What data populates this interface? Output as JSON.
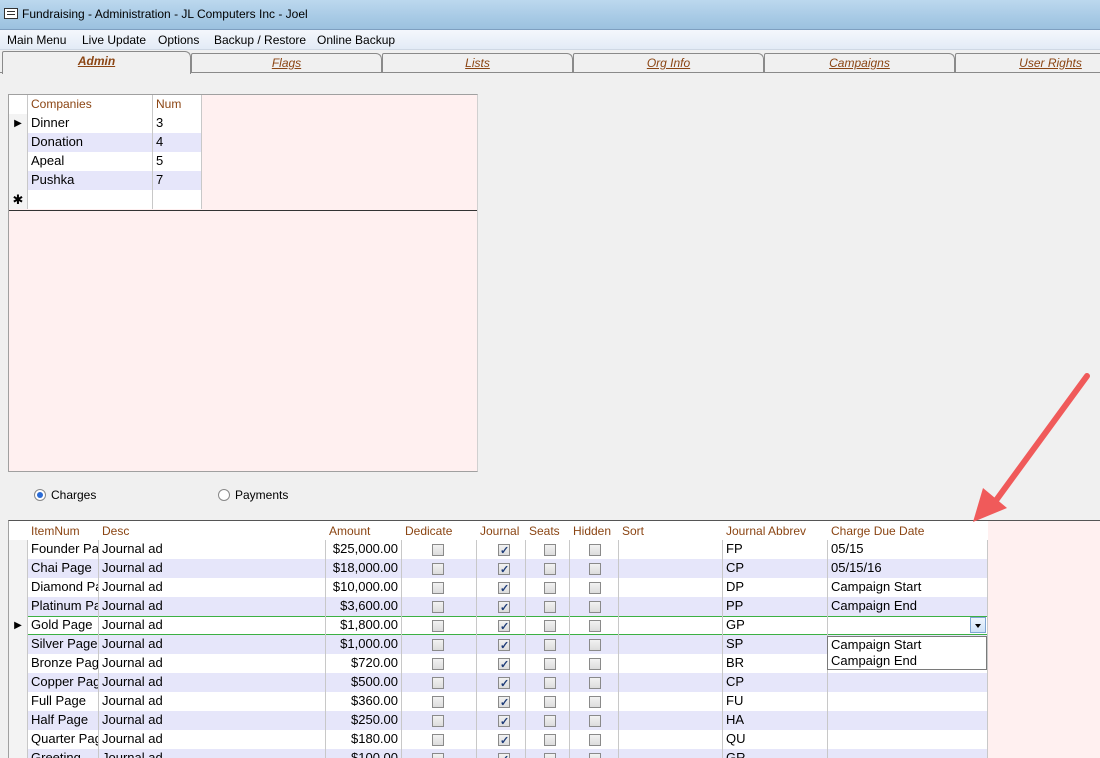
{
  "window": {
    "title": "Fundraising - Administration - JL Computers Inc - Joel"
  },
  "menu": [
    "Main Menu",
    "Live Update",
    "Options",
    "Backup / Restore",
    "Online Backup"
  ],
  "tabs": [
    "Admin",
    "Flags",
    "Lists",
    "Org Info",
    "Campaigns",
    "User Rights"
  ],
  "companies": {
    "headers": {
      "name": "Companies",
      "num": "Num"
    },
    "rows": [
      {
        "name": "Dinner",
        "num": "3"
      },
      {
        "name": "Donation",
        "num": "4"
      },
      {
        "name": "Apeal",
        "num": "5"
      },
      {
        "name": "Pushka",
        "num": "7"
      }
    ],
    "new_row_marker": "✱"
  },
  "radios": {
    "charges": "Charges",
    "payments": "Payments",
    "selected": "charges"
  },
  "charges": {
    "headers": {
      "itemnum": "ItemNum",
      "desc": "Desc",
      "amount": "Amount",
      "dedicate": "Dedicate",
      "journal": "Journal",
      "seats": "Seats",
      "hidden": "Hidden",
      "sort": "Sort",
      "abbrev": "Journal Abbrev",
      "due": "Charge Due Date"
    },
    "rows": [
      {
        "item": "Founder Pa",
        "desc": "Journal ad",
        "amount": "$25,000.00",
        "abbrev": "FP",
        "due": "05/15"
      },
      {
        "item": "Chai Page",
        "desc": "Journal ad",
        "amount": "$18,000.00",
        "abbrev": "CP",
        "due": "05/15/16"
      },
      {
        "item": "Diamond Pa",
        "desc": "Journal ad",
        "amount": "$10,000.00",
        "abbrev": "DP",
        "due": "Campaign Start"
      },
      {
        "item": "Platinum Pa",
        "desc": "Journal ad",
        "amount": "$3,600.00",
        "abbrev": "PP",
        "due": "Campaign End"
      },
      {
        "item": "Gold Page",
        "desc": "Journal ad",
        "amount": "$1,800.00",
        "abbrev": "GP",
        "due": ""
      },
      {
        "item": "Silver Page",
        "desc": "Journal ad",
        "amount": "$1,000.00",
        "abbrev": "SP",
        "due": ""
      },
      {
        "item": "Bronze Pag",
        "desc": "Journal ad",
        "amount": "$720.00",
        "abbrev": "BR",
        "due": ""
      },
      {
        "item": "Copper Pag",
        "desc": "Journal ad",
        "amount": "$500.00",
        "abbrev": "CP",
        "due": ""
      },
      {
        "item": "Full Page",
        "desc": "Journal ad",
        "amount": "$360.00",
        "abbrev": "FU",
        "due": ""
      },
      {
        "item": "Half Page",
        "desc": "Journal ad",
        "amount": "$250.00",
        "abbrev": "HA",
        "due": ""
      },
      {
        "item": "Quarter Pag",
        "desc": "Journal ad",
        "amount": "$180.00",
        "abbrev": "QU",
        "due": ""
      },
      {
        "item": "Greeting",
        "desc": "Journal ad",
        "amount": "$100.00",
        "abbrev": "GR",
        "due": ""
      }
    ],
    "current_row": 4,
    "dropdown_options": [
      "Campaign Start",
      "Campaign End"
    ]
  },
  "colors": {
    "header_text": "#8b4513",
    "alt_row": "#e6e6fa",
    "grid_bg": "#fff0f0",
    "arrow": "#f05a5a",
    "current_row_border": "#3cb043"
  }
}
